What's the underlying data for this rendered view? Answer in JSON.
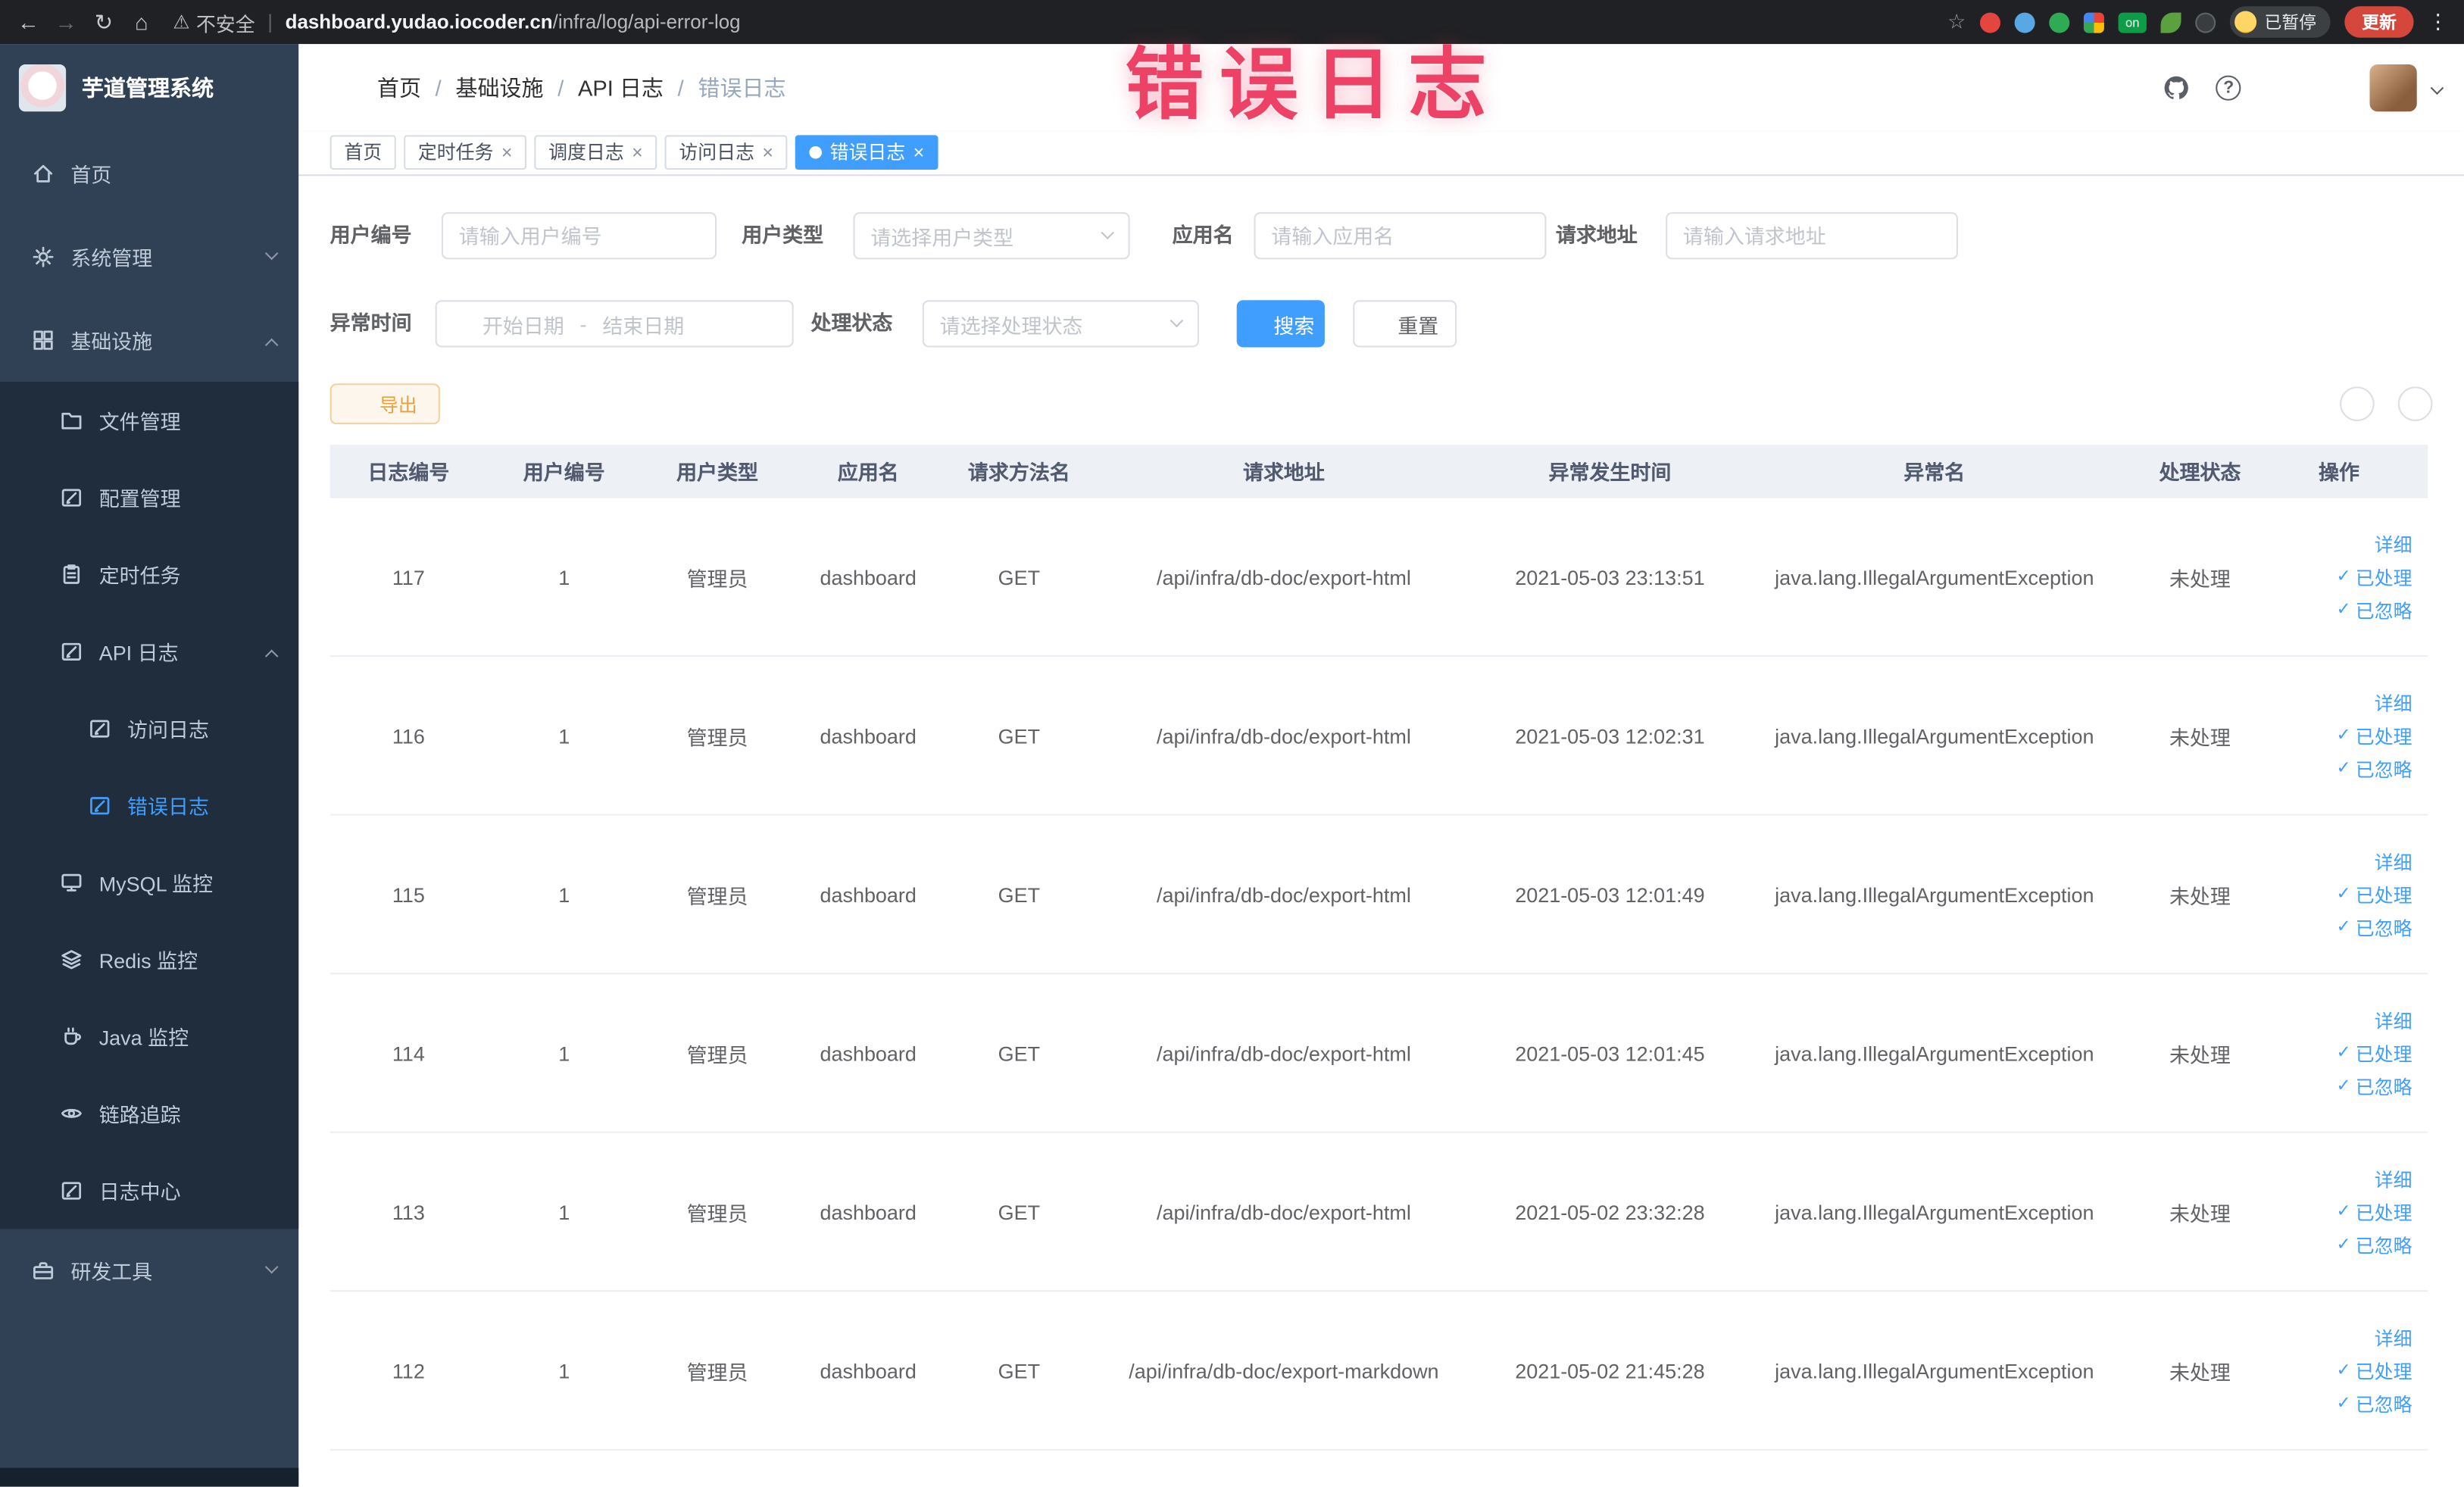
{
  "colors": {
    "accent": "#409eff",
    "warning": "#e6a23c",
    "annotation": "#ee4166",
    "sidebar_bg": "#304156",
    "submenu_bg": "#1f2d3d"
  },
  "glyphs": {
    "back": "←",
    "forward": "→",
    "reload": "↻",
    "home": "⌂",
    "warning": "⚠",
    "separator": "|",
    "star": "☆",
    "dots": "⋮",
    "close": "×",
    "check": "✓",
    "question": "?",
    "on_badge": "on"
  },
  "browser": {
    "security_label": "不安全",
    "url_host": "dashboard.yudao.iocoder.cn",
    "url_path": "/infra/log/api-error-log",
    "profile_badge": "已暂停",
    "update_button": "更新"
  },
  "annotation": {
    "text": "错误日志"
  },
  "sidebar": {
    "logo_title": "芋道管理系统",
    "items": [
      {
        "label": "首页",
        "icon": "home-icon"
      },
      {
        "label": "系统管理",
        "icon": "gear-icon",
        "expanded": false
      },
      {
        "label": "基础设施",
        "icon": "grid-icon",
        "expanded": true
      },
      {
        "label": "文件管理",
        "icon": "folder-icon"
      },
      {
        "label": "配置管理",
        "icon": "edit-icon"
      },
      {
        "label": "定时任务",
        "icon": "clipboard-icon"
      },
      {
        "label": "API 日志",
        "icon": "edit-icon",
        "expanded": true
      },
      {
        "label": "访问日志",
        "icon": "edit-icon"
      },
      {
        "label": "错误日志",
        "icon": "edit-icon",
        "active": true
      },
      {
        "label": "MySQL 监控",
        "icon": "monitor-icon"
      },
      {
        "label": "Redis 监控",
        "icon": "layers-icon"
      },
      {
        "label": "Java 监控",
        "icon": "coffee-icon"
      },
      {
        "label": "链路追踪",
        "icon": "eye-icon"
      },
      {
        "label": "日志中心",
        "icon": "edit-icon"
      },
      {
        "label": "研发工具",
        "icon": "toolbox-icon",
        "expanded": false
      }
    ]
  },
  "header": {
    "breadcrumb": [
      "首页",
      "基础设施",
      "API 日志",
      "错误日志"
    ]
  },
  "tabs": [
    {
      "label": "首页",
      "closable": false,
      "active": false
    },
    {
      "label": "定时任务",
      "closable": true,
      "active": false
    },
    {
      "label": "调度日志",
      "closable": true,
      "active": false
    },
    {
      "label": "访问日志",
      "closable": true,
      "active": false
    },
    {
      "label": "错误日志",
      "closable": true,
      "active": true
    }
  ],
  "filters": {
    "user_id_label": "用户编号",
    "user_id_placeholder": "请输入用户编号",
    "user_type_label": "用户类型",
    "user_type_placeholder": "请选择用户类型",
    "app_name_label": "应用名",
    "app_name_placeholder": "请输入应用名",
    "request_url_label": "请求地址",
    "request_url_placeholder": "请输入请求地址",
    "exception_time_label": "异常时间",
    "date_start_placeholder": "开始日期",
    "date_separator": "-",
    "date_end_placeholder": "结束日期",
    "status_label": "处理状态",
    "status_placeholder": "请选择处理状态",
    "search_button": "搜索",
    "reset_button": "重置"
  },
  "toolbar": {
    "export_button": "导出"
  },
  "table": {
    "columns": [
      "日志编号",
      "用户编号",
      "用户类型",
      "应用名",
      "请求方法名",
      "请求地址",
      "异常发生时间",
      "异常名",
      "处理状态",
      "操作"
    ],
    "action_detail": "详细",
    "action_processed": "已处理",
    "action_ignored": "已忽略",
    "rows": [
      {
        "id": "117",
        "user_id": "1",
        "user_type": "管理员",
        "app_name": "dashboard",
        "method": "GET",
        "request_url": "/api/infra/db-doc/export-html",
        "time": "2021-05-03 23:13:51",
        "exception": "java.lang.IllegalArgumentException",
        "status": "未处理"
      },
      {
        "id": "116",
        "user_id": "1",
        "user_type": "管理员",
        "app_name": "dashboard",
        "method": "GET",
        "request_url": "/api/infra/db-doc/export-html",
        "time": "2021-05-03 12:02:31",
        "exception": "java.lang.IllegalArgumentException",
        "status": "未处理"
      },
      {
        "id": "115",
        "user_id": "1",
        "user_type": "管理员",
        "app_name": "dashboard",
        "method": "GET",
        "request_url": "/api/infra/db-doc/export-html",
        "time": "2021-05-03 12:01:49",
        "exception": "java.lang.IllegalArgumentException",
        "status": "未处理"
      },
      {
        "id": "114",
        "user_id": "1",
        "user_type": "管理员",
        "app_name": "dashboard",
        "method": "GET",
        "request_url": "/api/infra/db-doc/export-html",
        "time": "2021-05-03 12:01:45",
        "exception": "java.lang.IllegalArgumentException",
        "status": "未处理"
      },
      {
        "id": "113",
        "user_id": "1",
        "user_type": "管理员",
        "app_name": "dashboard",
        "method": "GET",
        "request_url": "/api/infra/db-doc/export-html",
        "time": "2021-05-02 23:32:28",
        "exception": "java.lang.IllegalArgumentException",
        "status": "未处理"
      },
      {
        "id": "112",
        "user_id": "1",
        "user_type": "管理员",
        "app_name": "dashboard",
        "method": "GET",
        "request_url": "/api/infra/db-doc/export-markdown",
        "time": "2021-05-02 21:45:28",
        "exception": "java.lang.IllegalArgumentException",
        "status": "未处理"
      }
    ]
  }
}
